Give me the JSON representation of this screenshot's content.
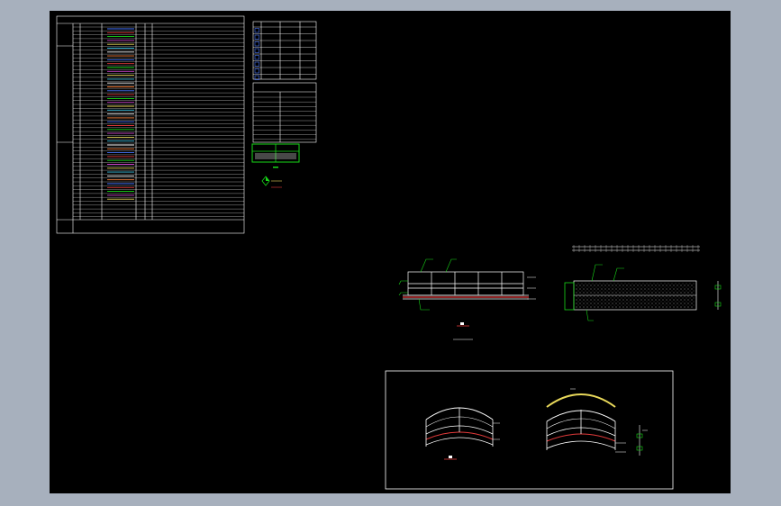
{
  "window": {
    "title": ""
  },
  "colors": {
    "background": "#a7b0bd",
    "canvas": "#000000",
    "line": "#ffffff",
    "accent_green": "#18d818",
    "accent_red": "#e23a3a",
    "accent_yellow": "#e8d85a",
    "accent_blue": "#4a78ff"
  },
  "legend_box": {
    "header_left": "",
    "header_right": ""
  },
  "icons": [
    "drawing-canvas",
    "layer-swatch-icon",
    "north-arrow-icon",
    "section-symbol-icon"
  ]
}
